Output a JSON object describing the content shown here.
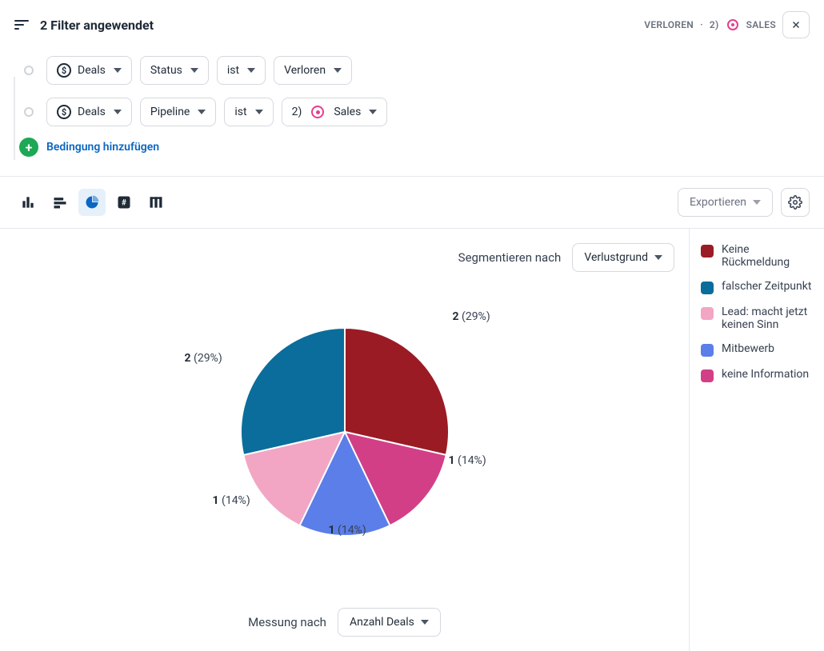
{
  "header": {
    "title": "2 Filter angewendet",
    "breadcrumb_left": "VERLOREN",
    "breadcrumb_sep": "·",
    "breadcrumb_num": "2)",
    "breadcrumb_right": "SALES"
  },
  "filters": {
    "row1": {
      "entity": "Deals",
      "field": "Status",
      "op": "ist",
      "value": "Verloren"
    },
    "row2": {
      "entity": "Deals",
      "field": "Pipeline",
      "op": "ist",
      "value_prefix": "2)",
      "value": "Sales"
    },
    "add_label": "Bedingung hinzufügen"
  },
  "toolbar": {
    "export": "Exportieren"
  },
  "segment": {
    "label": "Segmentieren nach",
    "value": "Verlustgrund"
  },
  "chart_data": {
    "type": "pie",
    "title": "",
    "series": [
      {
        "name": "Keine Rückmeldung",
        "value": 2,
        "percent": 29,
        "color": "#9a1b24"
      },
      {
        "name": "falscher Zeitpunkt",
        "value": 2,
        "percent": 29,
        "color": "#0b6d9b"
      },
      {
        "name": "Lead: macht jetzt keinen Sinn",
        "value": 1,
        "percent": 14,
        "color": "#f2a6c4"
      },
      {
        "name": "Mitbewerb",
        "value": 1,
        "percent": 14,
        "color": "#5b7ee8"
      },
      {
        "name": "keine Information",
        "value": 1,
        "percent": 14,
        "color": "#d23f87"
      }
    ],
    "labels": {
      "l0": "2 (29%)",
      "l1": "2 (29%)",
      "l2": "1 (14%)",
      "l3": "1 (14%)",
      "l4": "1 (14%)"
    }
  },
  "measure": {
    "label": "Messung nach",
    "value": "Anzahl Deals"
  },
  "legend": {
    "i0": "Keine Rückmeldung",
    "i1": "falscher Zeitpunkt",
    "i2": "Lead: macht jetzt keinen Sinn",
    "i3": "Mitbewerb",
    "i4": "keine Information"
  }
}
